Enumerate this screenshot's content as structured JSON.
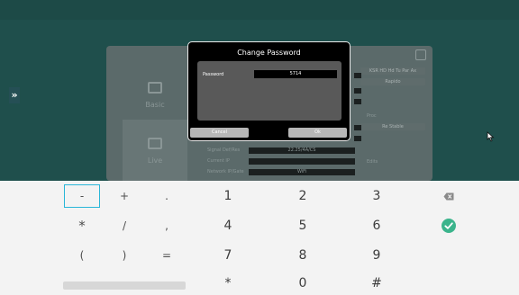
{
  "side_tab": {
    "glyph": "»"
  },
  "panel": {
    "categories": [
      {
        "label": "Basic",
        "icon": "monitor-icon"
      },
      {
        "label": "Live",
        "icon": "monitor-icon"
      }
    ],
    "right_chips": [
      "KSR HD Hd Tu Par Ax",
      "Rapido",
      "Re Stable"
    ],
    "rows": [
      {
        "label": "Signal Def/Res",
        "value": "22.25/4A/CS"
      },
      {
        "label": "Current IP",
        "value": ""
      },
      {
        "label": "Network IP/Gate",
        "value": "WiFi"
      }
    ],
    "mini_labels": [
      "Proc",
      "Edits"
    ]
  },
  "dialog": {
    "title": "Change Password",
    "password_label": "Password",
    "password_value": "5714",
    "cancel_label": "Cancel",
    "ok_label": "Ok"
  },
  "keyboard": {
    "rows": [
      [
        "-",
        "+",
        ".",
        "1",
        "2",
        "3"
      ],
      [
        "*",
        "/",
        ",",
        "4",
        "5",
        "6"
      ],
      [
        "(",
        ")",
        "=",
        "7",
        "8",
        "9"
      ],
      [
        "",
        "",
        "",
        "*",
        "0",
        "#"
      ]
    ],
    "focused_key": "-",
    "action_keys": {
      "backspace": "backspace-icon",
      "enter": "check-icon"
    },
    "colors": {
      "focus": "#29b6d8",
      "enter": "#3bb48c",
      "backspace": "#8a8a8a"
    }
  }
}
